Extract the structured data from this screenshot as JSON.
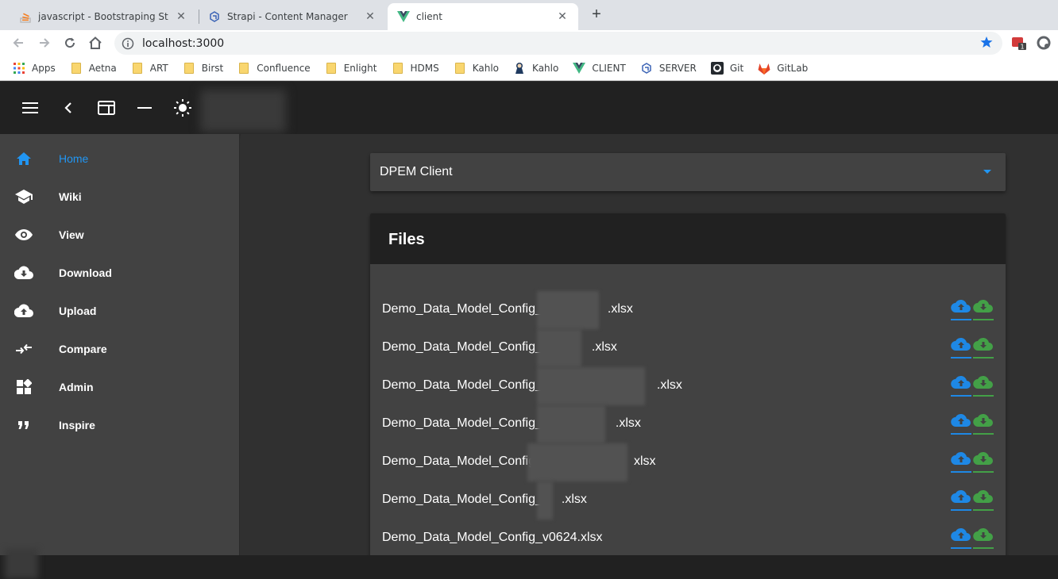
{
  "browser": {
    "tabs": [
      {
        "title": "javascript - Bootstraping Strapi R",
        "icon": "stackoverflow-icon"
      },
      {
        "title": "Strapi - Content Manager",
        "icon": "strapi-icon"
      },
      {
        "title": "client",
        "icon": "vue-icon"
      }
    ],
    "new_tab_label": "+",
    "close_label": "✕",
    "url": "localhost:3000",
    "bookmarks": [
      {
        "label": "Apps",
        "icon": "apps-grid-icon"
      },
      {
        "label": "Aetna",
        "icon": "folder-icon"
      },
      {
        "label": "ART",
        "icon": "folder-icon"
      },
      {
        "label": "Birst",
        "icon": "folder-icon"
      },
      {
        "label": "Confluence",
        "icon": "folder-icon"
      },
      {
        "label": "Enlight",
        "icon": "folder-icon"
      },
      {
        "label": "HDMS",
        "icon": "folder-icon"
      },
      {
        "label": "Kahlo",
        "icon": "folder-icon"
      },
      {
        "label": "Kahlo",
        "icon": "jenkins-icon"
      },
      {
        "label": "CLIENT",
        "icon": "vue-icon"
      },
      {
        "label": "SERVER",
        "icon": "strapi-icon"
      },
      {
        "label": "Git",
        "icon": "github-icon"
      },
      {
        "label": "GitLab",
        "icon": "gitlab-icon"
      }
    ]
  },
  "nav": {
    "items": [
      {
        "label": "Home",
        "icon": "home-icon",
        "active": true
      },
      {
        "label": "Wiki",
        "icon": "school-icon"
      },
      {
        "label": "View",
        "icon": "eye-icon"
      },
      {
        "label": "Download",
        "icon": "cloud-download-icon"
      },
      {
        "label": "Upload",
        "icon": "cloud-upload-icon"
      },
      {
        "label": "Compare",
        "icon": "compare-arrows-icon"
      },
      {
        "label": "Admin",
        "icon": "dashboard-icon"
      },
      {
        "label": "Inspire",
        "icon": "format-quote-icon"
      }
    ]
  },
  "select": {
    "value": "DPEM Client"
  },
  "files": {
    "title": "Files",
    "rows": [
      {
        "pre": "Demo_Data_Model_Config_",
        "post": ".xlsx"
      },
      {
        "pre": "Demo_Data_Model_Config_",
        "post": ".xlsx"
      },
      {
        "pre": "Demo_Data_Model_Config_",
        "post": ".xlsx"
      },
      {
        "pre": "Demo_Data_Model_Config_",
        "post": ".xlsx"
      },
      {
        "pre": "Demo_Data_Model_Config",
        "post": "xlsx"
      },
      {
        "pre": "Demo_Data_Model_Config_",
        "post": ".xlsx"
      },
      {
        "pre": "Demo_Data_Model_Config_v0624.xlsx",
        "post": ""
      }
    ]
  },
  "colors": {
    "accent": "#2196f3",
    "upload": "#1e88e5",
    "download": "#43a047",
    "appbar": "#212121",
    "drawer": "#424242",
    "background": "#303030"
  }
}
